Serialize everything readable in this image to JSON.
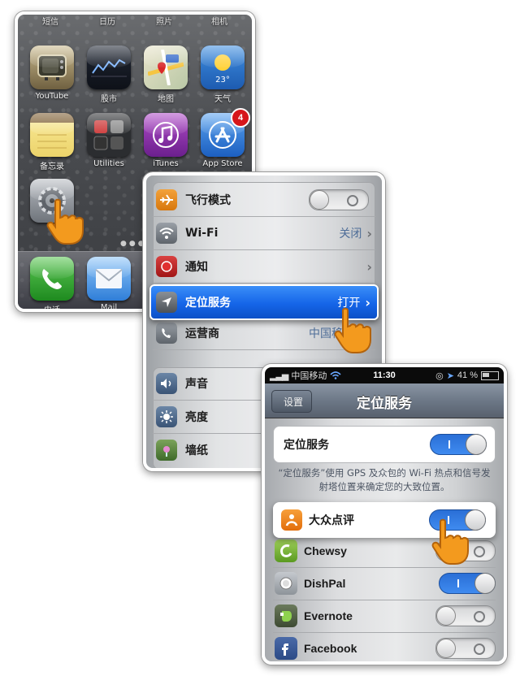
{
  "home": {
    "top_labels": [
      "短信",
      "日历",
      "照片",
      "相机"
    ],
    "apps_row1": [
      "YouTube",
      "股市",
      "地图",
      "天气"
    ],
    "weather_temp": "23°",
    "apps_row2": [
      "备忘录",
      "Utilities",
      "iTunes",
      "App Store"
    ],
    "app_store_badge": "4",
    "dock": [
      "电话",
      "Mail"
    ]
  },
  "settings": {
    "rows": [
      {
        "label": "飞行模式",
        "value": ""
      },
      {
        "label": "Wi-Fi",
        "value": "关闭"
      },
      {
        "label": "通知",
        "value": ""
      },
      {
        "label": "定位服务",
        "value": "打开"
      },
      {
        "label": "运营商",
        "value": "中国移"
      },
      {
        "label": "声音",
        "value": ""
      },
      {
        "label": "亮度",
        "value": ""
      },
      {
        "label": "墙纸",
        "value": ""
      }
    ]
  },
  "location": {
    "status": {
      "carrier": "中国移动",
      "time": "11:30",
      "battery": "41 %"
    },
    "back_label": "设置",
    "title": "定位服务",
    "master_label": "定位服务",
    "description": "“定位服务”使用 GPS 及众包的 Wi-Fi 热点和信号发射塔位置来确定您的大致位置。",
    "apps": [
      {
        "name": "大众点评",
        "enabled": true
      },
      {
        "name": "Chewsy",
        "enabled": false
      },
      {
        "name": "DishPal",
        "enabled": true
      },
      {
        "name": "Evernote",
        "enabled": false
      },
      {
        "name": "Facebook",
        "enabled": false
      }
    ]
  },
  "colors": {
    "accent_blue": "#1565e8",
    "badge_red": "#d6161b",
    "hand_orange": "#f39a1e"
  }
}
